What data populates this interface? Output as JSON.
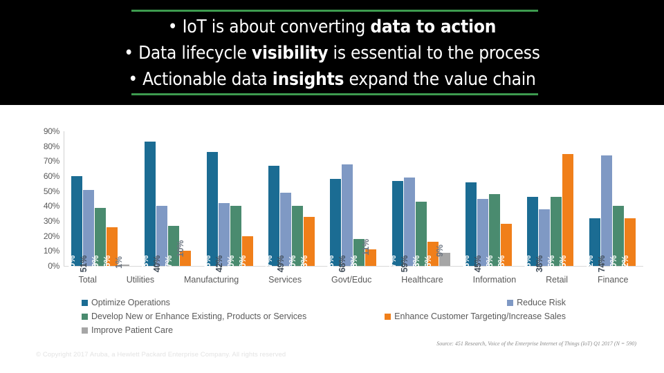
{
  "header": {
    "lines": [
      {
        "pre": "• IoT is about converting ",
        "bold": "data to action",
        "post": ""
      },
      {
        "pre": "• Data lifecycle ",
        "bold": "visibility",
        "post": " is essential to the process"
      },
      {
        "pre": "• Actionable data ",
        "bold": "insights",
        "post": " expand the value chain"
      }
    ],
    "rule_color": "#3d9b4f",
    "background": "#000000",
    "text_color": "#ffffff"
  },
  "chart_data": {
    "type": "bar",
    "title": "",
    "xlabel": "",
    "ylabel": "",
    "ylim": [
      0,
      90
    ],
    "grid": false,
    "legend_position": "bottom",
    "ytick_labels": [
      "90%",
      "80%",
      "70%",
      "60%",
      "50%",
      "40%",
      "30%",
      "20%",
      "10%",
      "0%"
    ],
    "ytick_values": [
      90,
      80,
      70,
      60,
      50,
      40,
      30,
      20,
      10,
      0
    ],
    "categories": [
      "Total",
      "Utilities",
      "Manufacturing",
      "Services",
      "Govt/Educ",
      "Healthcare",
      "Information",
      "Retail",
      "Finance"
    ],
    "series": [
      {
        "name": "Optimize Operations",
        "color": "#1B6C93",
        "values": [
          60,
          83,
          76,
          67,
          58,
          57,
          56,
          46,
          32
        ],
        "labels": [
          "60%",
          "83%",
          "76%",
          "67%",
          "58%",
          "57%",
          "56%",
          "46%",
          "32%"
        ]
      },
      {
        "name": "Reduce Risk",
        "color": "#7F99C4",
        "values": [
          51,
          40,
          42,
          49,
          68,
          59,
          45,
          38,
          74
        ],
        "labels": [
          "51%",
          "40%",
          "42%",
          "49%",
          "68%",
          "59%",
          "45%",
          "38%",
          "74%"
        ]
      },
      {
        "name": "Develop New or Enhance Existing, Products or Services",
        "color": "#4A8B6F",
        "values": [
          39,
          27,
          40,
          40,
          18,
          43,
          48,
          46,
          40
        ],
        "labels": [
          "39%",
          "27%",
          "40%",
          "40%",
          "18%",
          "43%",
          "48%",
          "46%",
          "40%"
        ]
      },
      {
        "name": "Enhance Customer Targeting/Increase Sales",
        "color": "#F07F1A",
        "values": [
          26,
          10,
          20,
          33,
          11,
          16,
          28,
          75,
          32
        ],
        "labels": [
          "26%",
          "10%",
          "20%",
          "33%",
          "11%",
          "16%",
          "28%",
          "75%",
          "32%"
        ]
      },
      {
        "name": "Improve Patient Care",
        "color": "#A6A6A6",
        "values": [
          1,
          null,
          null,
          null,
          null,
          9,
          null,
          null,
          null
        ],
        "labels": [
          "1%",
          "",
          "",
          "",
          "",
          "9%",
          "",
          "",
          ""
        ]
      }
    ]
  },
  "legend": {
    "rows": [
      [
        {
          "label": "Optimize Operations",
          "color": "#1B6C93"
        },
        {
          "label": "Reduce Risk",
          "color": "#7F99C4"
        }
      ],
      [
        {
          "label": "Develop New or Enhance Existing, Products or Services",
          "color": "#4A8B6F"
        },
        {
          "label": "Enhance Customer Targeting/Increase Sales",
          "color": "#F07F1A"
        }
      ],
      [
        {
          "label": "Improve Patient Care",
          "color": "#A6A6A6"
        }
      ]
    ]
  },
  "footer": {
    "source": "Source: 451 Research, Voice of the Enterprise Internet of Things (IoT) Q1 2017  (N = 590)",
    "copyright": "© Copyright 2017 Aruba, a Hewlett Packard Enterprise Company. All rights reserved"
  }
}
